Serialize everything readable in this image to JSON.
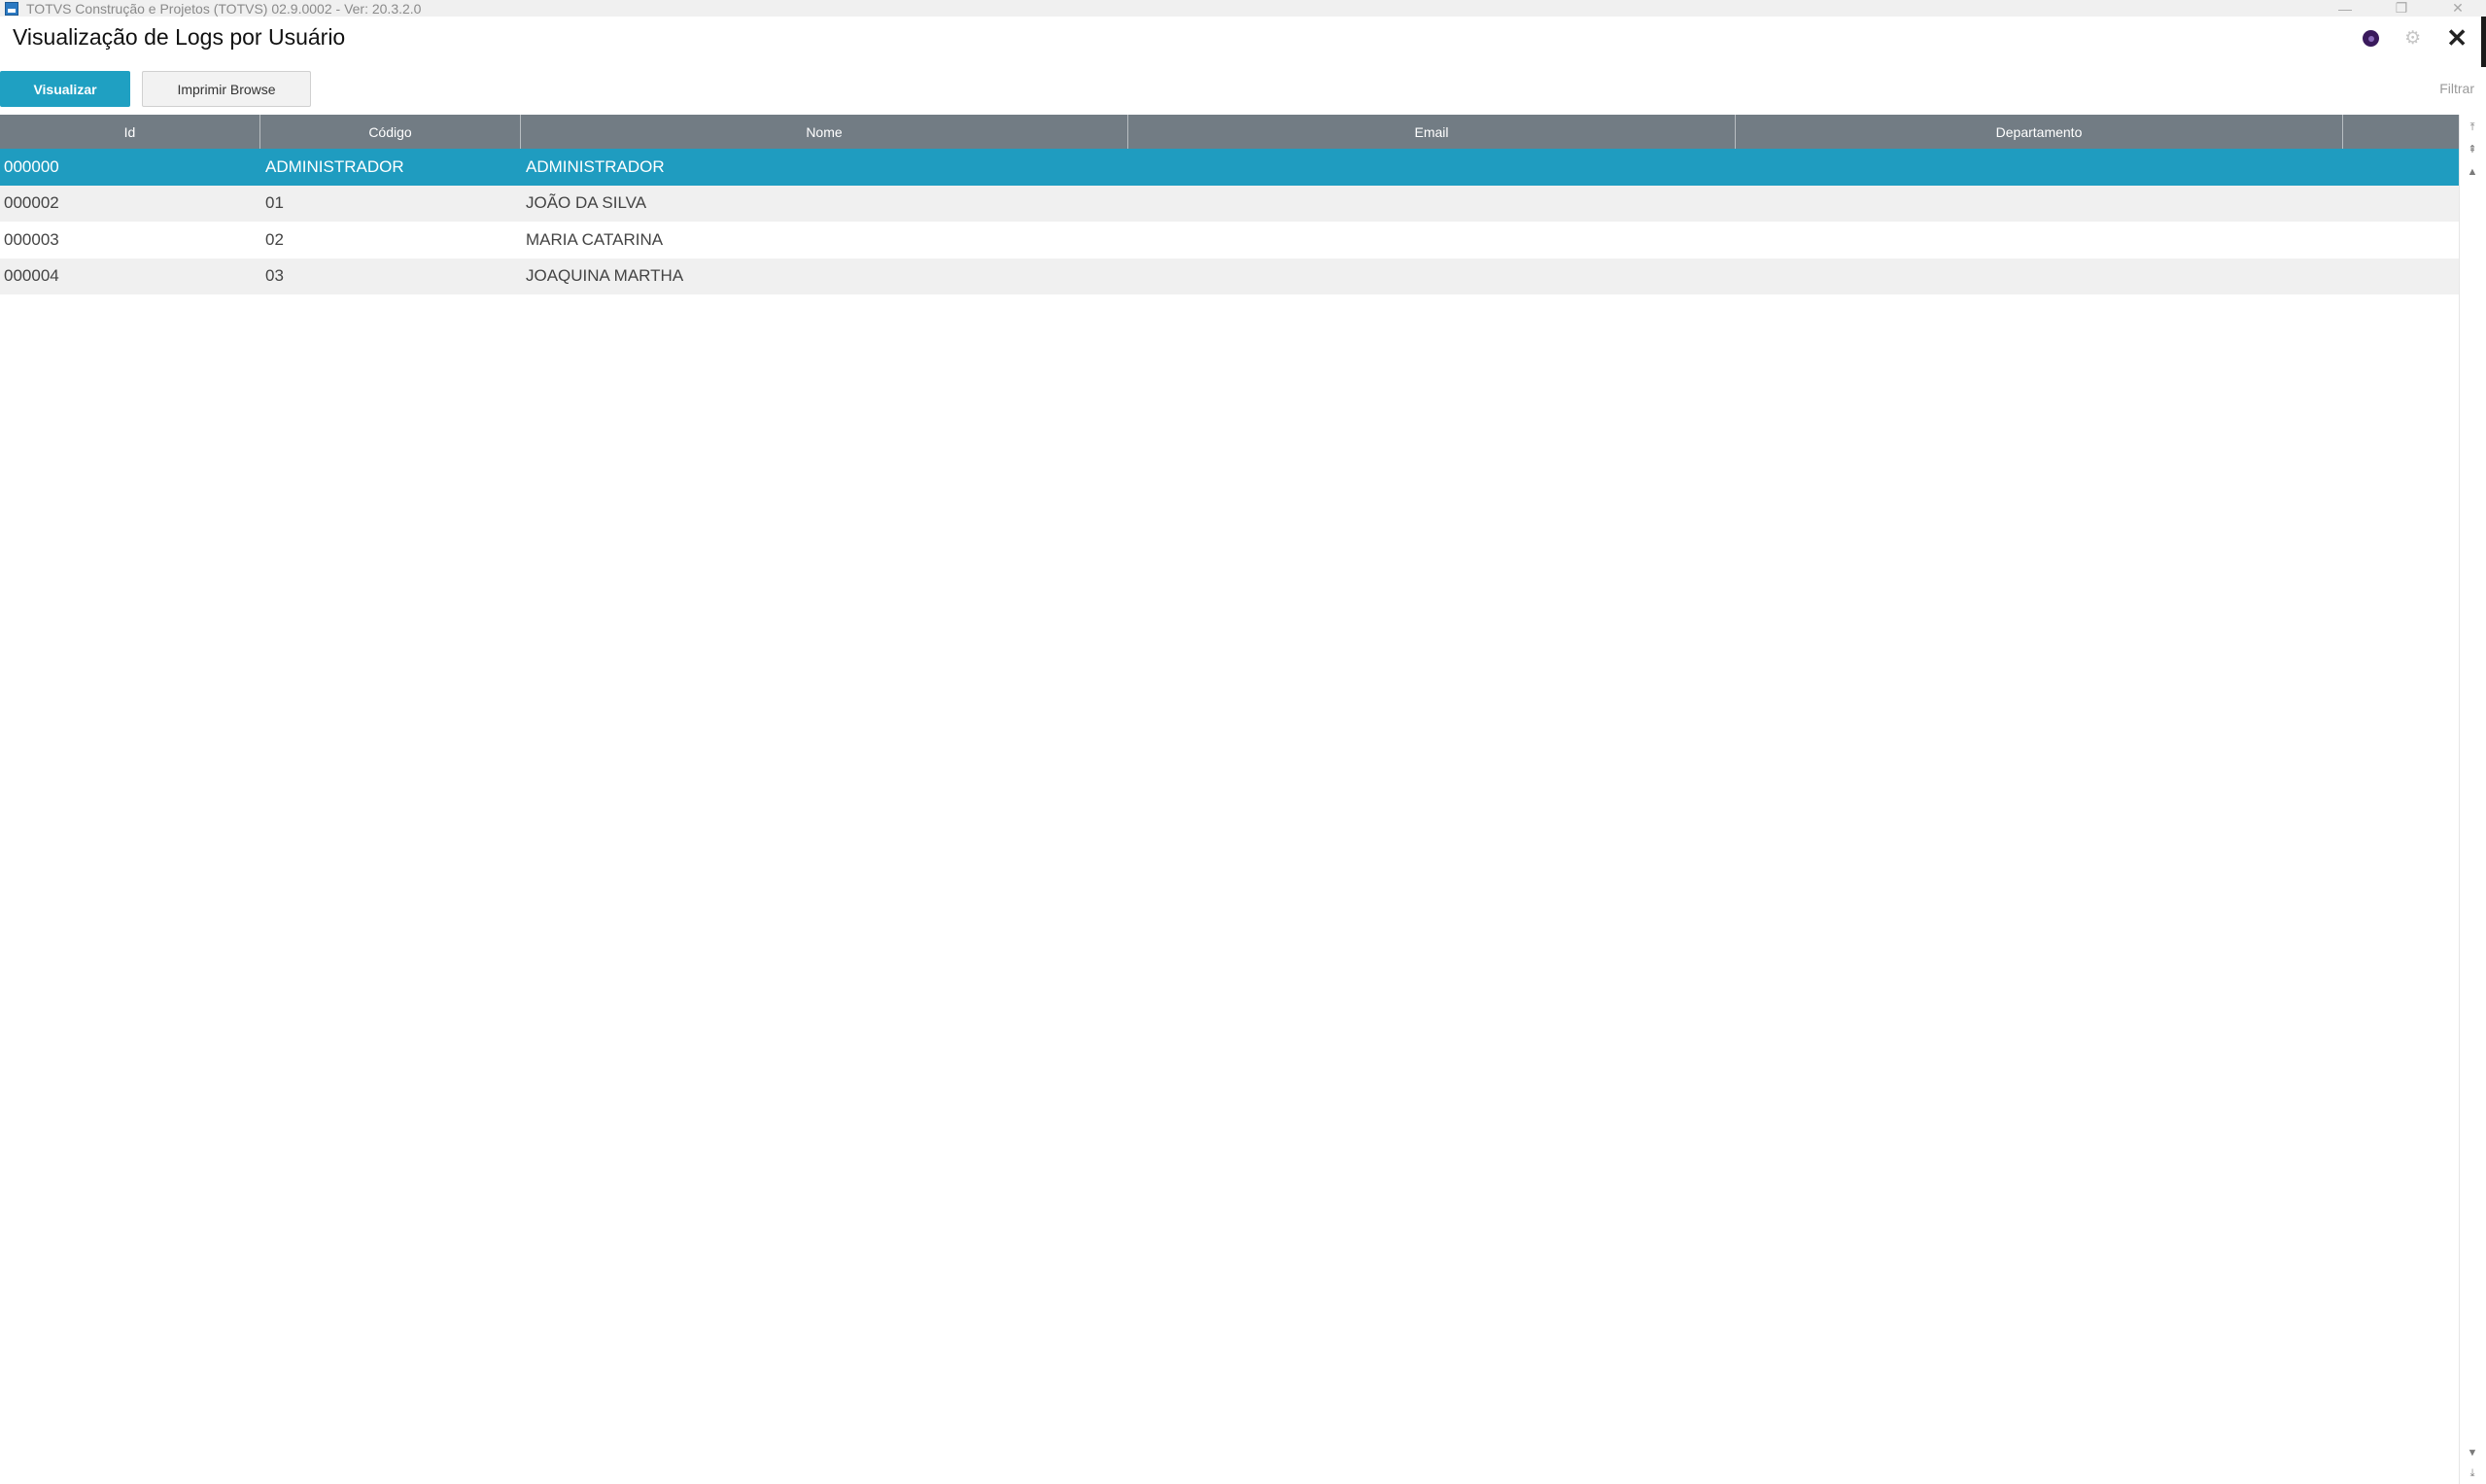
{
  "window": {
    "title": "TOTVS Construção e Projetos (TOTVS) 02.9.0002 - Ver: 20.3.2.0",
    "minimize_glyph": "—",
    "restore_glyph": "❐",
    "close_glyph": "✕"
  },
  "page": {
    "title": "Visualização de Logs por Usuário"
  },
  "icons": {
    "profile": "profile-icon",
    "settings": "gear-icon",
    "close": "close-icon",
    "gear_glyph": "⚙",
    "close_glyph": "✕"
  },
  "toolbar": {
    "primary_label": "Visualizar",
    "print_label": "Imprimir Browse",
    "filter_label": "Filtrar"
  },
  "grid": {
    "columns": [
      "Id",
      "Código",
      "Nome",
      "Email",
      "Departamento"
    ],
    "selected_row": 0,
    "rows": [
      {
        "id": "000000",
        "codigo": "ADMINISTRADOR",
        "nome": "ADMINISTRADOR",
        "email": "",
        "departamento": ""
      },
      {
        "id": "000002",
        "codigo": "01",
        "nome": "JOÃO DA SILVA",
        "email": "",
        "departamento": ""
      },
      {
        "id": "000003",
        "codigo": "02",
        "nome": "MARIA CATARINA",
        "email": "",
        "departamento": ""
      },
      {
        "id": "000004",
        "codigo": "03",
        "nome": "JOAQUINA MARTHA",
        "email": "",
        "departamento": ""
      }
    ]
  },
  "scrollbar": {
    "top_glyph": "⤒",
    "page_up_glyph": "⇞",
    "up_glyph": "▲",
    "down_glyph": "▼",
    "bottom_glyph": "⤓"
  },
  "colors": {
    "accent": "#1fa0c2",
    "selected_row": "#1f9cc0",
    "header_bg": "#727c84"
  }
}
